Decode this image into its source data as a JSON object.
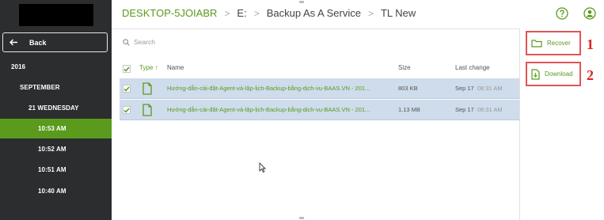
{
  "header": {
    "breadcrumbs": [
      "DESKTOP-5JOIABR",
      "E:",
      "Backup As A Service",
      "TL New"
    ],
    "help_icon": "help-circle-icon",
    "user_icon": "user-icon"
  },
  "sidebar": {
    "back_label": "Back",
    "tree": [
      {
        "label": "2016",
        "level": 0,
        "selected": false
      },
      {
        "label": "SEPTEMBER",
        "level": 1,
        "selected": false
      },
      {
        "label": "21 WEDNESDAY",
        "level": 2,
        "selected": false
      },
      {
        "label": "10:53 AM",
        "level": 3,
        "selected": true
      },
      {
        "label": "10:52 AM",
        "level": 3,
        "selected": false
      },
      {
        "label": "10:51 AM",
        "level": 3,
        "selected": false
      },
      {
        "label": "10:40 AM",
        "level": 3,
        "selected": false
      }
    ]
  },
  "search": {
    "placeholder": "Search"
  },
  "table": {
    "columns": {
      "type": "Type",
      "name": "Name",
      "size": "Size",
      "last_change": "Last change"
    },
    "rows": [
      {
        "checked": true,
        "name": "Hướng-dẫn-cài-đặt-Agent-và-lập-lịch-Backup-bằng-dịch-vụ-BAAS.VN - 201...",
        "size": "803 KB",
        "date": "Sep 17",
        "time": "08:31 AM"
      },
      {
        "checked": true,
        "name": "Hướng-dẫn-cài-đặt-Agent-và-lập-lịch-Backup-bằng-dịch-vụ-BAAS.VN - 201...",
        "size": "1.13 MB",
        "date": "Sep 17",
        "time": "08:31 AM"
      }
    ]
  },
  "actions": {
    "recover": {
      "label": "Recover",
      "badge": "1"
    },
    "download": {
      "label": "Download",
      "badge": "2"
    }
  },
  "colors": {
    "accent_green": "#5a9a1c",
    "sidebar_bg": "#2b2d2e",
    "selected_row": "#cfdcec",
    "annotation_red": "#e05555"
  }
}
